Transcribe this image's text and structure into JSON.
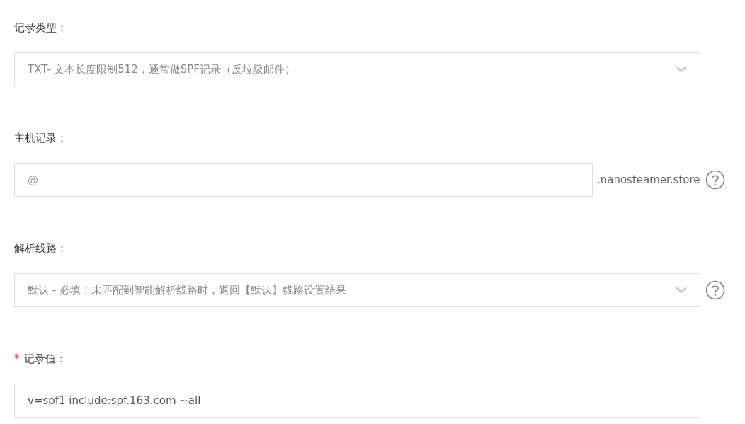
{
  "fields": [
    {
      "kind": "select",
      "label": "记录类型：",
      "value": "TXT- 文本长度限制512，通常做SPF记录（反垃圾邮件）",
      "help": false
    },
    {
      "kind": "input",
      "label": "主机记录：",
      "placeholder": "@",
      "suffix": ".nanosteamer.store",
      "help": true
    },
    {
      "kind": "select",
      "label": "解析线路：",
      "value": "默认 - 必填！未匹配到智能解析线路时，返回【默认】线路设置结果",
      "help": true
    },
    {
      "kind": "input",
      "label": "记录值：",
      "required_mark": "*",
      "value": "v=spf1 include:spf.163.com ~all",
      "help": false
    }
  ]
}
